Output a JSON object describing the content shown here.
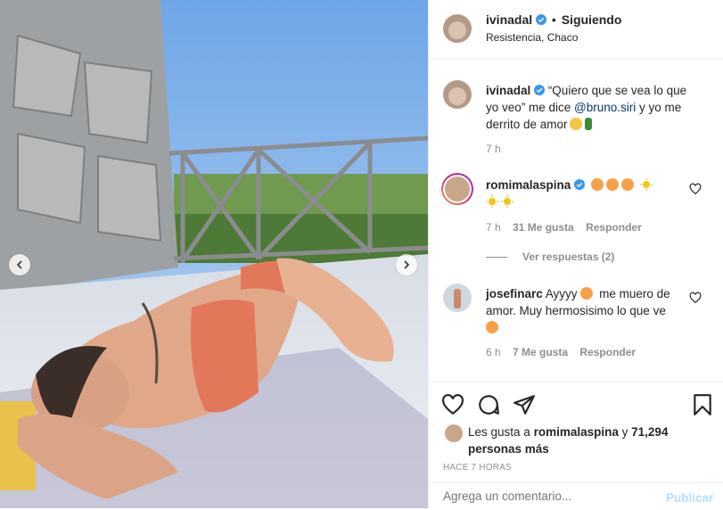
{
  "header": {
    "username": "ivinadal",
    "separator": "•",
    "follow_status": "Siguiendo",
    "location": "Resistencia, Chaco"
  },
  "caption": {
    "username": "ivinadal",
    "text_before": "“Quiero que se vea lo que yo veo” me dice ",
    "mention": "@bruno.siri",
    "text_after": " y yo me derrito de amor",
    "time": "7 h"
  },
  "comments": [
    {
      "username": "romimalaspina",
      "verified": true,
      "emojis": [
        "star-struck",
        "star-struck",
        "star-struck",
        "sun",
        "sun",
        "sun"
      ],
      "time": "7 h",
      "likes": "31 Me gusta",
      "reply": "Responder",
      "view_replies": "Ver respuestas (2)"
    },
    {
      "username": "josefinarc",
      "text1": "Ayyyy",
      "text2": "me muero de amor. Muy hermosisimo lo que ve",
      "time": "6 h",
      "likes": "7 Me gusta",
      "reply": "Responder"
    }
  ],
  "likes": {
    "prefix": "Les gusta a",
    "user": "romimalaspina",
    "suffix": "y",
    "count": "71,294 personas más"
  },
  "timestamp": "HACE 7 HORAS",
  "add_comment": {
    "placeholder": "Agrega un comentario...",
    "publish": "Publicar"
  },
  "colors": {
    "verified": "#3897f0",
    "link": "#00376b",
    "publish": "#b2dffc",
    "meta": "#8e8e8e"
  },
  "icons": [
    "heart-icon",
    "comment-icon",
    "share-icon",
    "bookmark-icon",
    "chevron-left-icon",
    "chevron-right-icon",
    "verified-icon"
  ]
}
